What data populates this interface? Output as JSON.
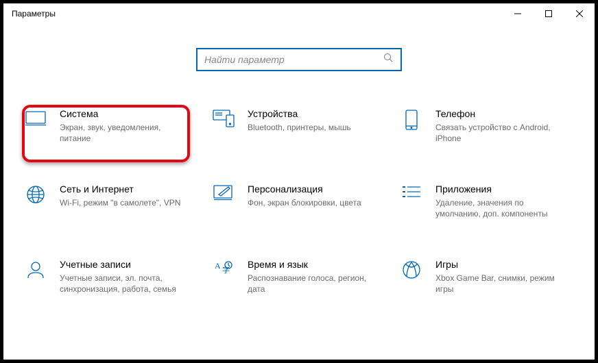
{
  "window": {
    "title": "Параметры"
  },
  "search": {
    "placeholder": "Найти параметр"
  },
  "tiles": [
    {
      "title": "Система",
      "desc": "Экран, звук, уведомления, питание"
    },
    {
      "title": "Устройства",
      "desc": "Bluetooth, принтеры, мышь"
    },
    {
      "title": "Телефон",
      "desc": "Связать устройство с Android, iPhone"
    },
    {
      "title": "Сеть и Интернет",
      "desc": "Wi-Fi, режим \"в самолете\", VPN"
    },
    {
      "title": "Персонализация",
      "desc": "Фон, экран блокировки, цвета"
    },
    {
      "title": "Приложения",
      "desc": "Удаление, значения по умолчанию, доп. компоненты"
    },
    {
      "title": "Учетные записи",
      "desc": "Учетные записи, эл. почта, синхронизация, работа, семья"
    },
    {
      "title": "Время и язык",
      "desc": "Распознавание голоса, регион, дата"
    },
    {
      "title": "Игры",
      "desc": "Xbox Game Bar, снимки, режим игры"
    }
  ]
}
